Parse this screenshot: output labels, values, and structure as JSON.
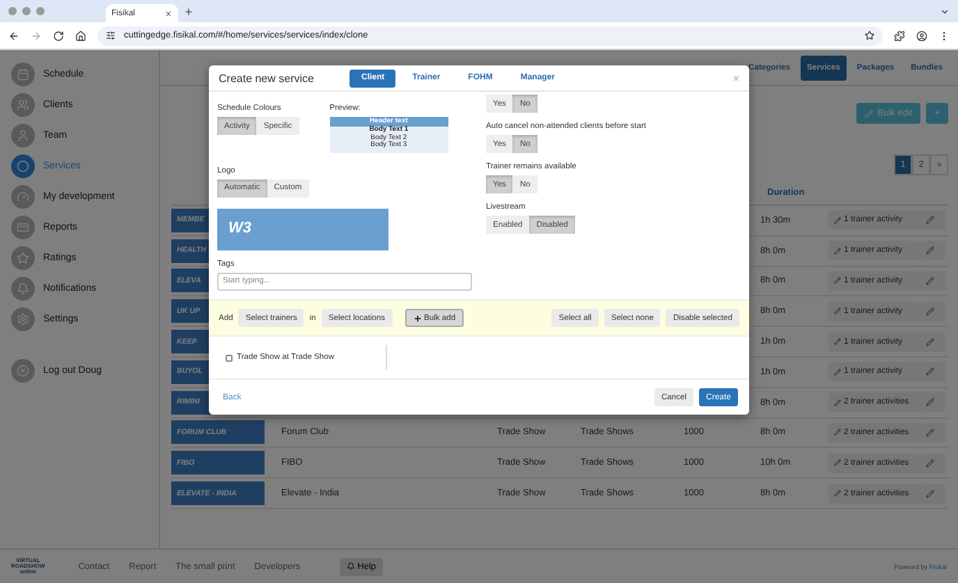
{
  "browser": {
    "tab_title": "Fisikal",
    "url": "cuttingedge.fisikal.com/#/home/services/services/index/clone"
  },
  "sidebar": {
    "items": [
      {
        "label": "Schedule",
        "selected": false
      },
      {
        "label": "Clients",
        "selected": false
      },
      {
        "label": "Team",
        "selected": false
      },
      {
        "label": "Services",
        "selected": true
      },
      {
        "label": "My development",
        "selected": false
      },
      {
        "label": "Reports",
        "selected": false
      },
      {
        "label": "Ratings",
        "selected": false
      },
      {
        "label": "Notifications",
        "selected": false
      },
      {
        "label": "Settings",
        "selected": false
      }
    ],
    "logout": "Log out Doug"
  },
  "top_nav": [
    {
      "label": "Categories",
      "selected": false
    },
    {
      "label": "Services",
      "selected": true
    },
    {
      "label": "Packages",
      "selected": false
    },
    {
      "label": "Bundles",
      "selected": false
    }
  ],
  "actions": {
    "bulk_edit": "Bulk edit",
    "add": "+"
  },
  "pagination": [
    {
      "label": "1",
      "selected": true
    },
    {
      "label": "2",
      "selected": false
    },
    {
      "label": "»",
      "selected": false
    }
  ],
  "table": {
    "duration_header": "Duration",
    "rows": [
      {
        "logo": "MEMBE",
        "duration": "1h 30m",
        "activities": "1 trainer activity"
      },
      {
        "logo": "HEALTH",
        "duration": "8h 0m",
        "activities": "1 trainer activity"
      },
      {
        "logo": "ELEVA",
        "duration": "8h 0m",
        "activities": "1 trainer activity"
      },
      {
        "logo": "UK UP",
        "duration": "8h 0m",
        "activities": "1 trainer activity"
      },
      {
        "logo": "KEEP",
        "duration": "1h 0m",
        "activities": "1 trainer activity"
      },
      {
        "logo": "BUYOL",
        "duration": "1h 0m",
        "activities": "1 trainer activity"
      },
      {
        "logo": "RIMINI",
        "duration": "8h 0m",
        "activities": "2 trainer activities"
      },
      {
        "logo": "FORUM CLUB",
        "name": "Forum Club",
        "type": "Trade Show",
        "category": "Trade Shows",
        "capacity": "1000",
        "duration": "8h 0m",
        "activities": "2 trainer activities"
      },
      {
        "logo": "FIBO",
        "name": "FIBO",
        "type": "Trade Show",
        "category": "Trade Shows",
        "capacity": "1000",
        "duration": "10h 0m",
        "activities": "2 trainer activities"
      },
      {
        "logo": "ELEVATE - INDIA",
        "name": "Elevate - India",
        "type": "Trade Show",
        "category": "Trade Shows",
        "capacity": "1000",
        "duration": "8h 0m",
        "activities": "2 trainer activities"
      }
    ]
  },
  "footer": {
    "logo": [
      "VIRTUAL",
      "ROADSHOW",
      "online"
    ],
    "links": [
      "Contact",
      "Report",
      "The small print",
      "Developers"
    ],
    "help": "Help",
    "powered_by": "Powered by",
    "brand": "Fisikal"
  },
  "modal": {
    "title": "Create new service",
    "tabs": [
      {
        "label": "Client",
        "selected": true
      },
      {
        "label": "Trainer",
        "selected": false
      },
      {
        "label": "FOHM",
        "selected": false
      },
      {
        "label": "Manager",
        "selected": false
      }
    ],
    "close": "×",
    "schedule_colours": {
      "label": "Schedule Colours",
      "options": [
        {
          "label": "Activity",
          "selected": true
        },
        {
          "label": "Specific",
          "selected": false
        }
      ]
    },
    "preview": {
      "label": "Preview:",
      "header": "Header text",
      "lines": [
        {
          "text": "Body Text 1",
          "bold": true
        },
        {
          "text": "Body Text 2",
          "bold": false
        },
        {
          "text": "Body Text 3",
          "bold": false
        }
      ]
    },
    "logo": {
      "label": "Logo",
      "options": [
        {
          "label": "Automatic",
          "selected": true
        },
        {
          "label": "Custom",
          "selected": false
        }
      ],
      "badge": "W3"
    },
    "tags": {
      "label": "Tags",
      "placeholder": "Start typing..."
    },
    "toggles": [
      {
        "options": [
          {
            "label": "Yes",
            "selected": false
          },
          {
            "label": "No",
            "selected": true
          }
        ]
      },
      {
        "label": "Auto cancel non-attended clients before start",
        "options": [
          {
            "label": "Yes",
            "selected": false
          },
          {
            "label": "No",
            "selected": true
          }
        ]
      },
      {
        "label": "Trainer remains available",
        "options": [
          {
            "label": "Yes",
            "selected": true
          },
          {
            "label": "No",
            "selected": false
          }
        ]
      },
      {
        "label": "Livestream",
        "options": [
          {
            "label": "Enabled",
            "selected": false
          },
          {
            "label": "Disabled",
            "selected": true
          }
        ]
      }
    ],
    "bulk_bar": {
      "add": "Add",
      "trainers": "Select trainers",
      "in": "in",
      "locations": "Select locations",
      "bulk_add": "Bulk add",
      "right_buttons": [
        "Select all",
        "Select none",
        "Disable selected"
      ]
    },
    "checks": [
      {
        "label": "Trade Show at Trade Show",
        "checked": false
      }
    ],
    "back": "Back",
    "cancel": "Cancel",
    "create": "Create"
  }
}
